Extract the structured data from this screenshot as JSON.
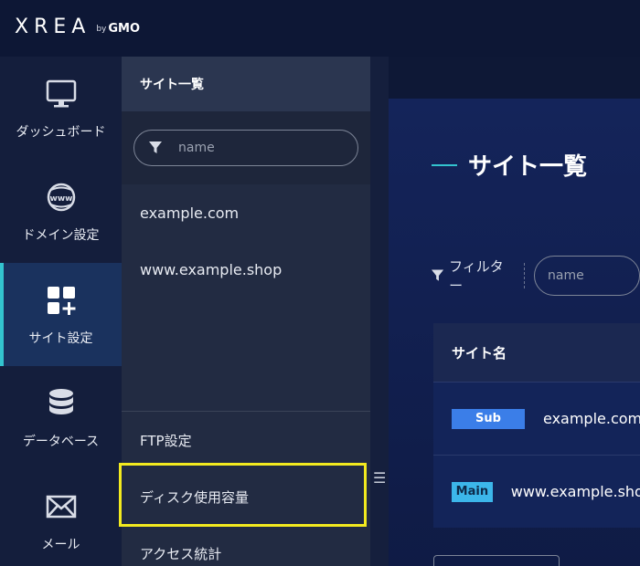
{
  "header": {
    "logo_main": "XREA",
    "logo_by": "by",
    "logo_gmo": "GMO"
  },
  "nav": {
    "items": [
      {
        "label": "ダッシュボード",
        "icon": "monitor-icon",
        "active": false
      },
      {
        "label": "ドメイン設定",
        "icon": "www-globe-icon",
        "active": false
      },
      {
        "label": "サイト設定",
        "icon": "site-add-icon",
        "active": true
      },
      {
        "label": "データベース",
        "icon": "database-icon",
        "active": false
      },
      {
        "label": "メール",
        "icon": "mail-icon",
        "active": false
      }
    ]
  },
  "subpanel": {
    "title": "サイト一覧",
    "search_placeholder": "name",
    "sites": [
      "example.com",
      "www.example.shop"
    ],
    "menu": [
      "FTP設定",
      "ディスク使用容量",
      "アクセス統計"
    ],
    "highlighted_item": "ディスク使用容量"
  },
  "main": {
    "page_title": "サイト一覧",
    "filter_label": "フィルター",
    "filter_placeholder": "name",
    "table": {
      "header": "サイト名",
      "rows": [
        {
          "badge": "Sub",
          "domain": "example.com"
        },
        {
          "badge": "Main",
          "domain": "www.example.shop"
        }
      ]
    }
  },
  "colors": {
    "accent": "#33c4cf",
    "highlight": "#f3ea1f",
    "badge_sub": "#3b7ee8",
    "badge_main": "#3cb6ea"
  }
}
